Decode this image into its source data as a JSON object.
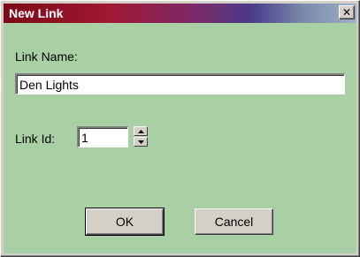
{
  "window": {
    "title": "New Link",
    "close_glyph": "✕",
    "client_bg": "#a9cfa5",
    "titlebar_gradient": [
      "#7d0a16",
      "#a01832",
      "#7a2a6a",
      "#4a3a8a",
      "#a0b0c8"
    ]
  },
  "form": {
    "link_name_label": "Link Name:",
    "link_name_value": "Den Lights",
    "link_id_label": "Link Id:",
    "link_id_value": "1"
  },
  "buttons": {
    "ok_label": "OK",
    "cancel_label": "Cancel"
  },
  "icons": {
    "close": "close-icon",
    "spin_up": "arrow-up-icon",
    "spin_down": "arrow-down-icon"
  }
}
